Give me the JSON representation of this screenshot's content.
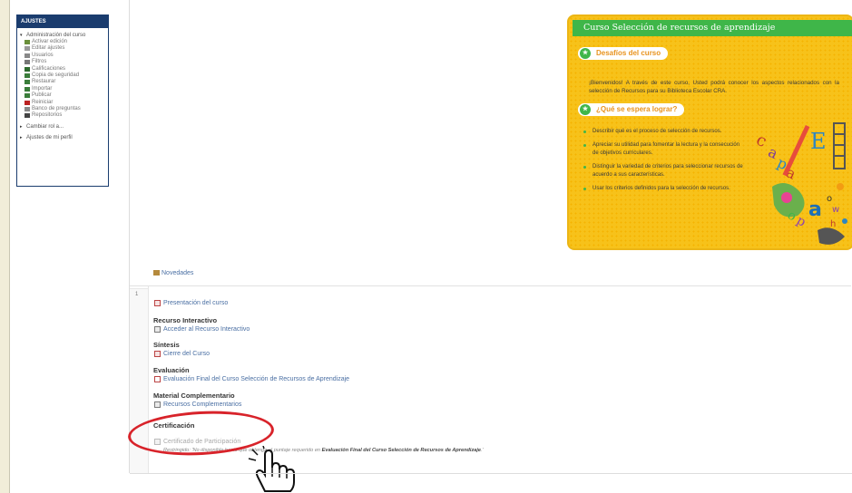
{
  "settings": {
    "title": "AJUSTES",
    "admin_label": "Administración del curso",
    "admin_items": [
      "Activar edición",
      "Editar ajustes",
      "Usuarios",
      "Filtros",
      "Calificaciones",
      "Copia de seguridad",
      "Restaurar",
      "Importar",
      "Publicar",
      "Reiniciar",
      "Banco de preguntas",
      "Repositorios"
    ],
    "change_role": "Cambiar rol a...",
    "profile": "Ajustes de mi perfil"
  },
  "course_panel": {
    "title": "Curso Selección de recursos de aprendizaje",
    "challenges_heading": "Desafíos del curso",
    "intro": "¡Bienvenidos! A través de este curso, Usted podrá conocer los aspectos relacionados con la selección de Recursos para su Biblioteca Escolar CRA.",
    "goals_heading": "¿Qué se espera lograr?",
    "goals": [
      "Describir qué es el proceso de selección de recursos.",
      "Apreciar su utilidad para fomentar la lectura y la consecución de objetivos curriculares.",
      "Distinguir la variedad de criterios para seleccionar recursos de acuerdo a sus características.",
      "Usar los criterios definidos para la selección de recursos."
    ]
  },
  "news": "Novedades",
  "section": {
    "number": "1",
    "presentation": "Presentación del curso",
    "interactive_heading": "Recurso Interactivo",
    "interactive_link": "Acceder al Recurso Interactivo",
    "synthesis_heading": "Síntesis",
    "synthesis_link": "Cierre del Curso",
    "evaluation_heading": "Evaluación",
    "evaluation_link": "Evaluación Final del Curso Selección de Recursos de Aprendizaje",
    "material_heading": "Material Complementario",
    "material_link": "Recursos Complementarios",
    "cert_heading": "Certificación",
    "cert_link": "Certificado de Participación",
    "restriction_prefix": "Restringido: 'No disponible hasta que obtenga el puntaje requerido en",
    "restriction_target": "Evaluación Final del Curso Selección de Recursos de Aprendizaje",
    "restriction_suffix": ".'"
  },
  "colors": {
    "accent_green": "#3fb649",
    "panel_yellow": "#f7c21a",
    "link_blue": "#4a6fa3",
    "highlight_red": "#d8232a",
    "block_navy": "#1a3c6e"
  }
}
